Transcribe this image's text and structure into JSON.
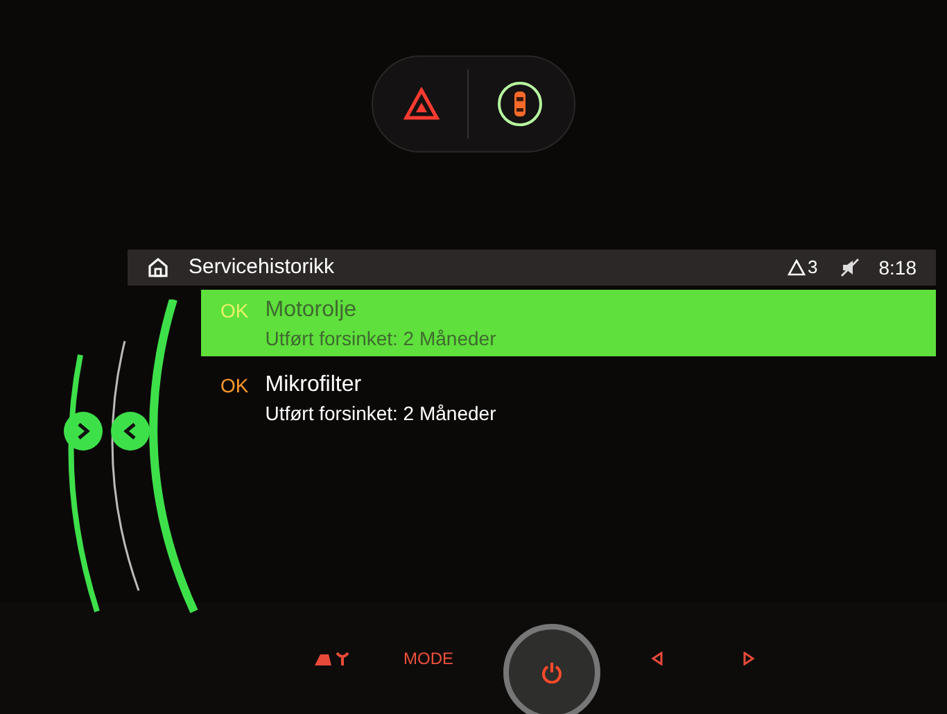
{
  "header": {
    "title": "Servicehistorikk",
    "warning_count": "3",
    "time": "8:18"
  },
  "service_items": [
    {
      "status": "OK",
      "title": "Motorolje",
      "detail": "Utført forsinket: 2 Måneder",
      "selected": true
    },
    {
      "status": "OK",
      "title": "Mikrofilter",
      "detail": "Utført forsinket: 2 Måneder",
      "selected": false
    }
  ],
  "controls": {
    "mode_label": "MODE"
  }
}
